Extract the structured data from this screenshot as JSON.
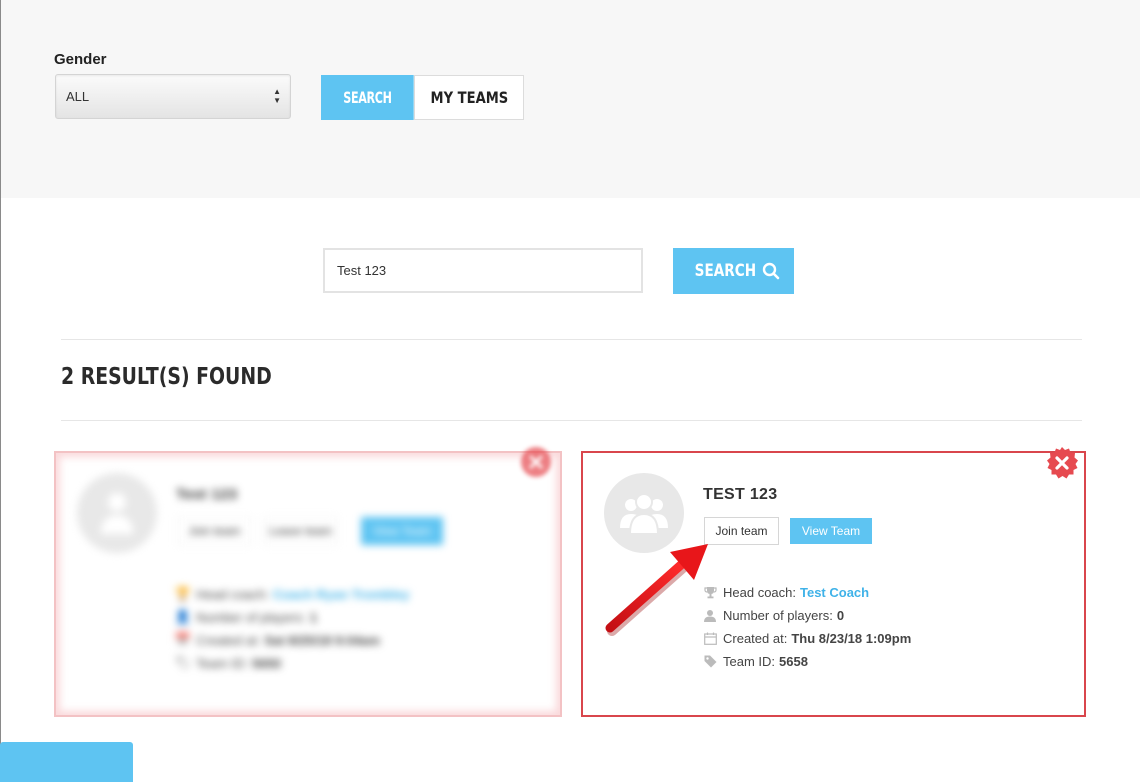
{
  "filters": {
    "gender_label": "Gender",
    "gender_value": "ALL",
    "search_tab_label": "SEARCH",
    "my_teams_label": "MY TEAMS"
  },
  "search": {
    "query": "Test 123",
    "button_label": "SEARCH"
  },
  "results": {
    "title": "2 RESULT(S) FOUND",
    "blurred_card": {
      "team_name": "Test 123",
      "join_label": "Join team",
      "leave_label": "Leave team",
      "view_label": "View Team",
      "head_coach_label": "Head coach:",
      "head_coach": "Coach Ryan Trombley",
      "players_label": "Number of players:",
      "players": "1",
      "created_label": "Created at:",
      "created": "Sat 8/25/18 9:04am",
      "team_id_label": "Team ID:",
      "team_id": "5650"
    },
    "card": {
      "team_name": "TEST 123",
      "join_label": "Join team",
      "view_label": "View Team",
      "head_coach_label": "Head coach:",
      "head_coach": "Test Coach",
      "players_label": "Number of players:",
      "players": "0",
      "created_label": "Created at:",
      "created": "Thu 8/23/18 1:09pm",
      "team_id_label": "Team ID:",
      "team_id": "5658"
    }
  },
  "colors": {
    "accent": "#5ec4f2",
    "danger": "#d9464c",
    "link": "#3fb2e8"
  },
  "icons": [
    "users-icon",
    "trophy-icon",
    "user-icon",
    "calendar-icon",
    "tag-icon",
    "close-icon",
    "search-icon"
  ]
}
